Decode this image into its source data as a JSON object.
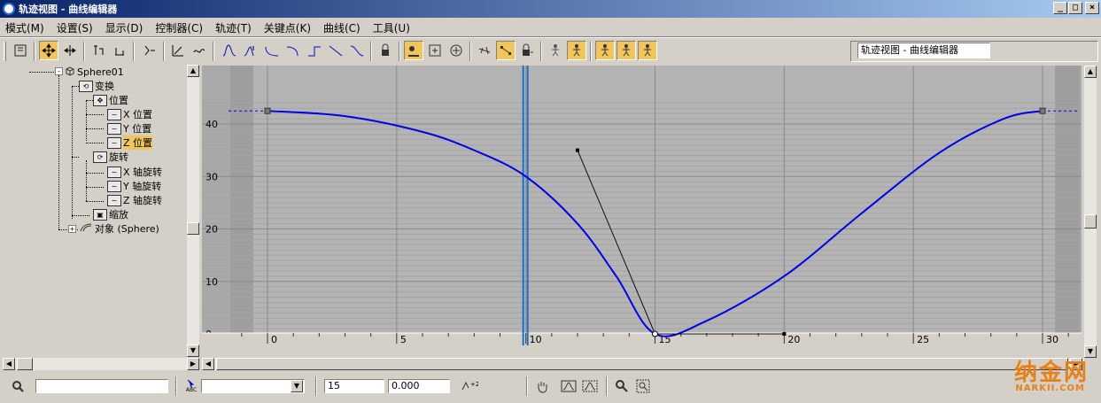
{
  "window": {
    "title": "轨迹视图 - 曲线编辑器",
    "minimize": "_",
    "maximize": "□",
    "close": "×"
  },
  "menu": [
    "模式(M)",
    "设置(S)",
    "显示(D)",
    "控制器(C)",
    "轨迹(T)",
    "关键点(K)",
    "曲线(C)",
    "工具(U)"
  ],
  "toolbar": {
    "name_field": "轨迹视图 - 曲线编辑器",
    "icons": [
      "filter-icon",
      "move-keys-icon",
      "slide-keys-icon",
      "scale-keys-icon",
      "scale-values-icon",
      "add-keys-icon",
      "draw-curves-icon",
      "reduce-keys-icon",
      "tangent-auto-icon",
      "tangent-custom-icon",
      "tangent-fast-icon",
      "tangent-slow-icon",
      "tangent-step-icon",
      "tangent-linear-icon",
      "tangent-smooth-icon",
      "lock-tangents-icon",
      "snap-frames-icon",
      "lock-selection-icon",
      "param-curve-out-icon",
      "show-keyable-icon",
      "show-tangents-icon",
      "lock-icon",
      "biped-icon"
    ]
  },
  "tree": {
    "items": [
      {
        "label": "Sphere01"
      },
      {
        "label": "变换"
      },
      {
        "label": "位置"
      },
      {
        "label": "X 位置"
      },
      {
        "label": "Y 位置"
      },
      {
        "label": "Z 位置"
      },
      {
        "label": "旋转"
      },
      {
        "label": "X 轴旋转"
      },
      {
        "label": "Y 轴旋转"
      },
      {
        "label": "Z 轴旋转"
      },
      {
        "label": "缩放"
      },
      {
        "label": "对象 (Sphere)"
      }
    ]
  },
  "graph": {
    "y_ticks": [
      "40",
      "30",
      "20",
      "10",
      "0"
    ],
    "x_ticks": [
      "0",
      "5",
      "10",
      "15",
      "20",
      "25",
      "30"
    ],
    "curve_color": "#0000e6",
    "time_marker_color": "#1a6fc8",
    "current_frame": 10
  },
  "chart_data": {
    "type": "line",
    "title": "",
    "xlabel": "",
    "ylabel": "",
    "xlim": [
      -1,
      31
    ],
    "ylim": [
      -1,
      45
    ],
    "series": [
      {
        "points": [
          [
            0,
            42.5
          ],
          [
            3,
            41.5
          ],
          [
            6,
            38.5
          ],
          [
            8,
            35
          ],
          [
            10,
            30
          ],
          [
            12,
            21
          ],
          [
            13.5,
            11
          ],
          [
            15,
            0
          ],
          [
            17,
            2.5
          ],
          [
            20,
            11
          ],
          [
            23,
            23
          ],
          [
            26,
            34.5
          ],
          [
            28.5,
            41
          ],
          [
            30,
            42.5
          ]
        ]
      }
    ],
    "keys": [
      [
        0,
        42.5
      ],
      [
        15,
        0
      ],
      [
        30,
        42.5
      ]
    ],
    "tangent_handles": [
      [
        12,
        35
      ],
      [
        20,
        0
      ]
    ]
  },
  "status": {
    "frame": "15",
    "value": "0.000",
    "left_field": "",
    "dropdown_value": "",
    "abc_label": "ABC"
  },
  "watermark": {
    "text": "纳金网",
    "sub": "NARKII.COM"
  }
}
